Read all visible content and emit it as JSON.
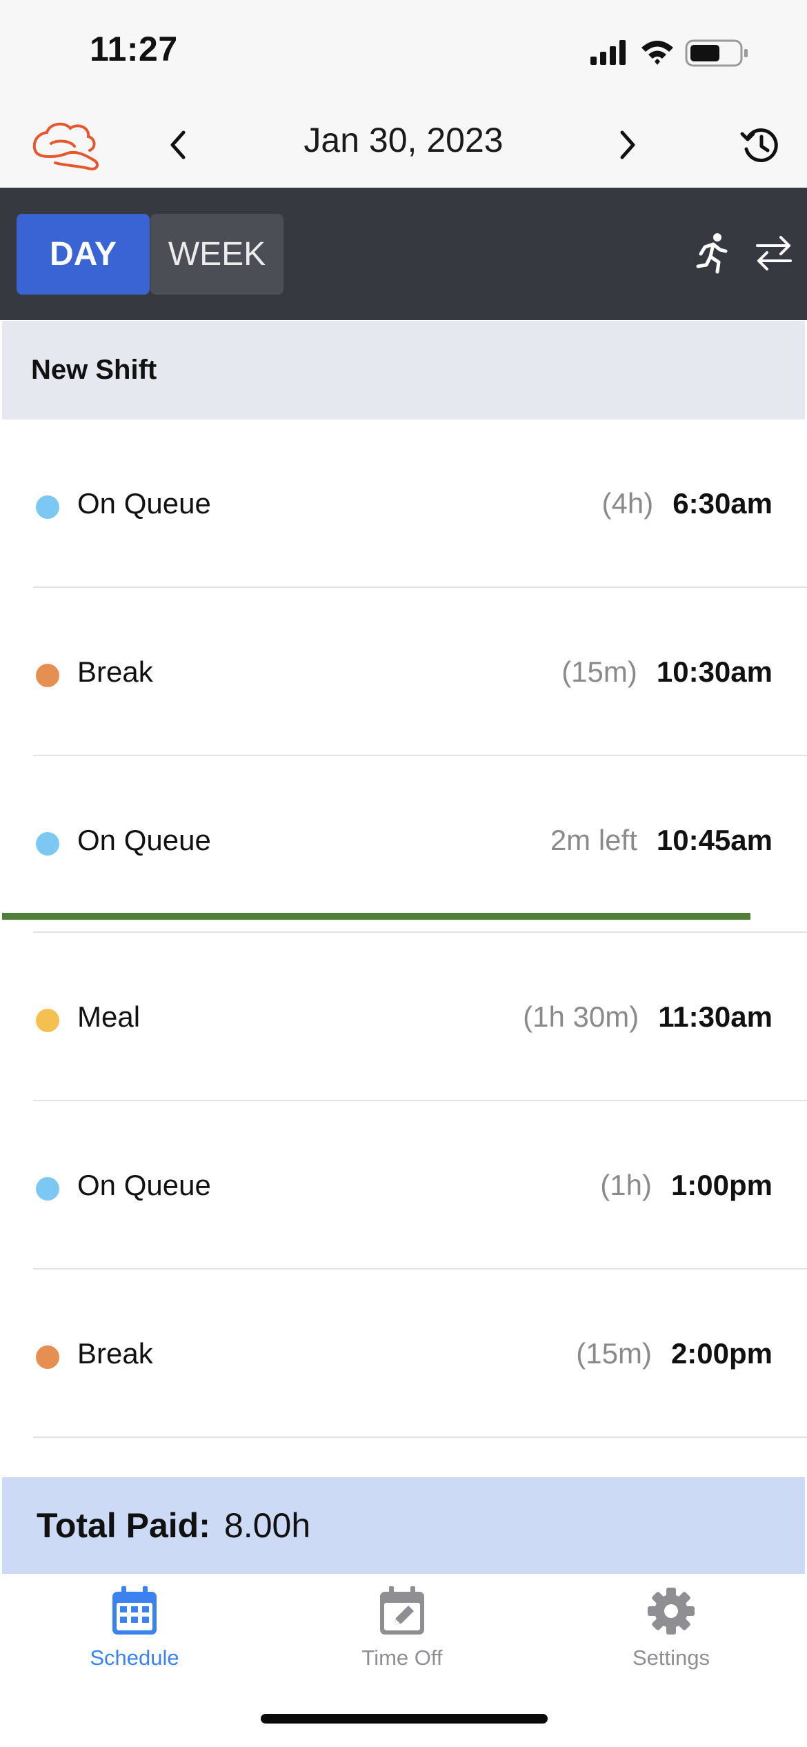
{
  "status_bar": {
    "time": "11:27"
  },
  "nav": {
    "date": "Jan 30, 2023"
  },
  "view_toggle": {
    "day_label": "DAY",
    "week_label": "WEEK",
    "selected": "DAY"
  },
  "section": {
    "title": "New Shift"
  },
  "activities": [
    {
      "label": "On Queue",
      "duration": "(4h)",
      "time": "6:30am",
      "color": "#7cc8f3"
    },
    {
      "label": "Break",
      "duration": "(15m)",
      "time": "10:30am",
      "color": "#e58f52"
    },
    {
      "label": "On Queue",
      "duration": "2m left",
      "time": "10:45am",
      "color": "#7cc8f3"
    },
    {
      "label": "Meal",
      "duration": "(1h 30m)",
      "time": "11:30am",
      "color": "#f4c150"
    },
    {
      "label": "On Queue",
      "duration": "(1h)",
      "time": "1:00pm",
      "color": "#7cc8f3"
    },
    {
      "label": "Break",
      "duration": "(15m)",
      "time": "2:00pm",
      "color": "#e58f52"
    }
  ],
  "total": {
    "label": "Total Paid:",
    "value": "8.00h"
  },
  "tabs": [
    {
      "label": "Schedule",
      "icon": "calendar-icon",
      "active": true
    },
    {
      "label": "Time Off",
      "icon": "calendar-edit-icon",
      "active": false
    },
    {
      "label": "Settings",
      "icon": "gear-icon",
      "active": false
    }
  ],
  "colors": {
    "accent": "#3a63d4",
    "tab_active": "#3b82f0",
    "tab_inactive": "#8e8e93",
    "logo": "#e5572f",
    "progress": "#4f7f38",
    "total_bg": "#ccdaf6",
    "toolbar_bg": "#363940"
  }
}
